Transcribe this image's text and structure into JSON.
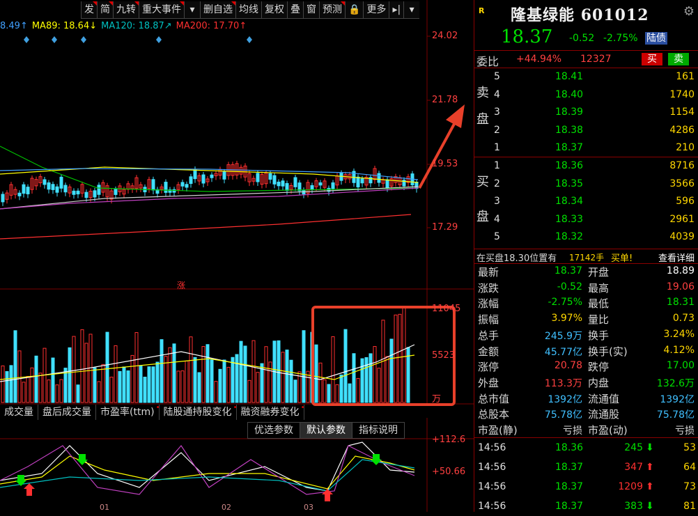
{
  "toolbar": {
    "buttons": [
      "发",
      "简",
      "九转",
      "重大事件",
      "▾",
      "删自选",
      "均线",
      "复权",
      "叠",
      "窗",
      "预测",
      "🔒",
      "更多",
      "▸|",
      "▾"
    ]
  },
  "ma_legend": [
    {
      "label": "8.49↑",
      "color": "#40a0ff"
    },
    {
      "label": "MA89: 18.64↓",
      "color": "#ffff00"
    },
    {
      "label": "MA120: 18.87↗",
      "color": "#00c0c0"
    },
    {
      "label": "MA200: 17.70↑",
      "color": "#ff3030"
    }
  ],
  "price_axis": [
    "24.02",
    "21.78",
    "19.53",
    "17.29"
  ],
  "volume_axis": [
    "11045",
    "5523",
    "万"
  ],
  "indicator_axis": [
    "+112.6",
    "+50.66"
  ],
  "zhang_label": "涨",
  "indicator_tabs": [
    "成交量",
    "盘后成交量",
    "市盈率(ttm)",
    "陆股通持股变化",
    "融资融券变化"
  ],
  "param_tabs": [
    "优选参数",
    "默认参数",
    "指标说明"
  ],
  "date_labels": [
    "01",
    "02",
    "03"
  ],
  "stock": {
    "badge": "R",
    "name": "隆基绿能",
    "code": "601012",
    "price": "18.37",
    "change": "-0.52",
    "change_pct": "-2.75%",
    "tag": "陆债"
  },
  "weibi": {
    "label": "委比",
    "pct": "+44.94%",
    "diff": "12327",
    "buy_label": "买",
    "sell_label": "卖"
  },
  "sell_side_label": [
    "卖",
    "盘"
  ],
  "buy_side_label": [
    "买",
    "盘"
  ],
  "asks": [
    {
      "level": "5",
      "price": "18.41",
      "vol": "161"
    },
    {
      "level": "4",
      "price": "18.40",
      "vol": "1740"
    },
    {
      "level": "3",
      "price": "18.39",
      "vol": "1154"
    },
    {
      "level": "2",
      "price": "18.38",
      "vol": "4286"
    },
    {
      "level": "1",
      "price": "18.37",
      "vol": "210"
    }
  ],
  "bids": [
    {
      "level": "1",
      "price": "18.36",
      "vol": "8716"
    },
    {
      "level": "2",
      "price": "18.35",
      "vol": "3566"
    },
    {
      "level": "3",
      "price": "18.34",
      "vol": "596"
    },
    {
      "level": "4",
      "price": "18.33",
      "vol": "2961"
    },
    {
      "level": "5",
      "price": "18.32",
      "vol": "4039"
    }
  ],
  "big_order": {
    "text": "在买盘18.30位置有",
    "vol": "17142手",
    "tail": "买单!",
    "link": "查看详细"
  },
  "stats": [
    {
      "k1": "最新",
      "v1": "18.37",
      "c1": "#00e000",
      "k2": "开盘",
      "v2": "18.89",
      "c2": "#ffffff"
    },
    {
      "k1": "涨跌",
      "v1": "-0.52",
      "c1": "#00e000",
      "k2": "最高",
      "v2": "19.06",
      "c2": "#ff4040"
    },
    {
      "k1": "涨幅",
      "v1": "-2.75%",
      "c1": "#00e000",
      "k2": "最低",
      "v2": "18.31",
      "c2": "#00e000"
    },
    {
      "k1": "振幅",
      "v1": "3.97%",
      "c1": "#ffd700",
      "k2": "量比",
      "v2": "0.73",
      "c2": "#ffd700"
    },
    {
      "k1": "总手",
      "v1": "245.9万",
      "c1": "#40c0ff",
      "k2": "换手",
      "v2": "3.24%",
      "c2": "#ffd700"
    },
    {
      "k1": "金额",
      "v1": "45.77亿",
      "c1": "#40c0ff",
      "k2": "换手(实)",
      "v2": "4.12%",
      "c2": "#ffd700"
    },
    {
      "k1": "涨停",
      "v1": "20.78",
      "c1": "#ff4040",
      "k2": "跌停",
      "v2": "17.00",
      "c2": "#00e000"
    },
    {
      "k1": "外盘",
      "v1": "113.3万",
      "c1": "#ff4040",
      "k2": "内盘",
      "v2": "132.6万",
      "c2": "#00e000"
    },
    {
      "k1": "总市值",
      "v1": "1392亿",
      "c1": "#40c0ff",
      "k2": "流通值",
      "v2": "1392亿",
      "c2": "#40c0ff"
    },
    {
      "k1": "总股本",
      "v1": "75.78亿",
      "c1": "#40c0ff",
      "k2": "流通股",
      "v2": "75.78亿",
      "c2": "#40c0ff"
    },
    {
      "k1": "市盈(静)",
      "v1": "亏损",
      "c1": "#d8d8d8",
      "k2": "市盈(动)",
      "v2": "亏损",
      "c2": "#d8d8d8"
    }
  ],
  "ticks": [
    {
      "time": "14:56",
      "price": "18.36",
      "vol": "245",
      "dir": "down",
      "n": "53"
    },
    {
      "time": "14:56",
      "price": "18.37",
      "vol": "347",
      "dir": "up",
      "n": "64"
    },
    {
      "time": "14:56",
      "price": "18.37",
      "vol": "1209",
      "dir": "up",
      "n": "73"
    },
    {
      "time": "14:56",
      "price": "18.37",
      "vol": "383",
      "dir": "down",
      "n": "81"
    }
  ],
  "colors": {
    "up": "#ff3030",
    "down": "#00e000",
    "accent": "#e8402a",
    "cyan": "#40e0ff"
  }
}
